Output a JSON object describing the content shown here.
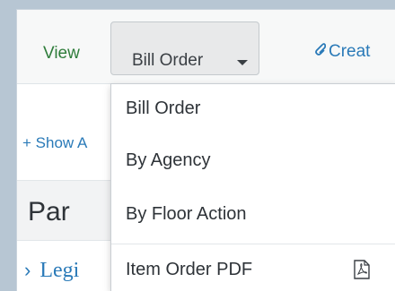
{
  "toolbar": {
    "view_label": "View",
    "view_button_label": "Bill Order",
    "create_label": "Creat"
  },
  "content": {
    "show_link": "+ Show A",
    "heading": "Par",
    "legislation_link": "Legi"
  },
  "dropdown": {
    "items": [
      {
        "label": "Bill Order"
      },
      {
        "label": "By Agency"
      },
      {
        "label": "By Floor Action"
      },
      {
        "label": "Item Order PDF",
        "icon": "pdf-icon"
      }
    ]
  },
  "colors": {
    "background": "#b7c6d3",
    "link": "#2a7ab8",
    "view_green": "#2f7d3b"
  }
}
